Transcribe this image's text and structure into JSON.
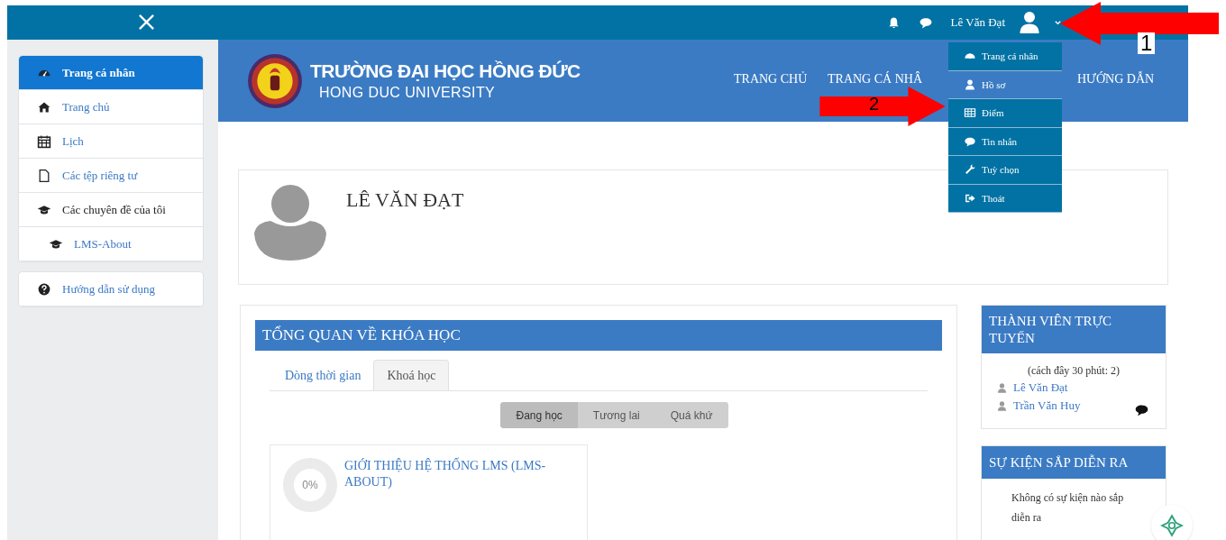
{
  "topbar": {
    "user_name": "Lê Văn Đạt"
  },
  "user_menu": [
    {
      "label": "Trang cá nhân",
      "selected": false
    },
    {
      "label": "Hồ sơ",
      "selected": true
    },
    {
      "label": "Điểm",
      "selected": false
    },
    {
      "label": "Tin nhắn",
      "selected": false
    },
    {
      "label": "Tuỳ chọn",
      "selected": false
    },
    {
      "label": "Thoát",
      "selected": false
    }
  ],
  "sidebar": {
    "groups": [
      {
        "items": [
          {
            "label": "Trang cá nhân",
            "kind": "link",
            "selected": true
          },
          {
            "label": "Trang chủ",
            "kind": "link",
            "selected": false
          },
          {
            "label": "Lịch",
            "kind": "link",
            "selected": false
          },
          {
            "label": "Các tệp riêng tư",
            "kind": "link",
            "selected": false
          },
          {
            "label": "Các chuyên đề của tôi",
            "kind": "heading",
            "selected": false,
            "children": [
              {
                "label": "LMS-About",
                "kind": "link",
                "selected": false
              }
            ]
          }
        ]
      },
      {
        "items": [
          {
            "label": "Hướng dẫn sử dụng",
            "kind": "link",
            "selected": false
          }
        ]
      }
    ]
  },
  "banner": {
    "title": "TRƯỜNG ĐẠI HỌC HỒNG ĐỨC",
    "subtitle": "HONG DUC UNIVERSITY",
    "nav": [
      "TRANG CHỦ",
      "TRANG CÁ NHÂ",
      "HƯỚNG DẪN"
    ]
  },
  "profile": {
    "name": "LÊ VĂN ĐẠT"
  },
  "course_overview": {
    "title": "TỔNG QUAN VỀ KHÓA HỌC",
    "tabs": [
      {
        "label": "Dòng thời gian",
        "selected": false
      },
      {
        "label": "Khoá học",
        "selected": true
      }
    ],
    "filters": [
      {
        "label": "Đang học",
        "selected": true
      },
      {
        "label": "Tương lai",
        "selected": false
      },
      {
        "label": "Quá khứ",
        "selected": false
      }
    ],
    "courses": [
      {
        "title": "GIỚI THIỆU HỆ THỐNG LMS (LMS-ABOUT)",
        "progress": "0%",
        "level": 0
      }
    ]
  },
  "online_users": {
    "title": "THÀNH VIÊN TRỰC TUYẾN",
    "note": "(cách đây 30 phút: 2)",
    "users": [
      "Lê Văn Đạt",
      "Trần Văn Huy"
    ]
  },
  "upcoming_events": {
    "title": "SỰ KIỆN SẮP DIỄN RA",
    "message": "Không có sự kiện nào sắp diễn ra"
  },
  "annotations": [
    {
      "label": "1"
    },
    {
      "label": "2"
    }
  ]
}
